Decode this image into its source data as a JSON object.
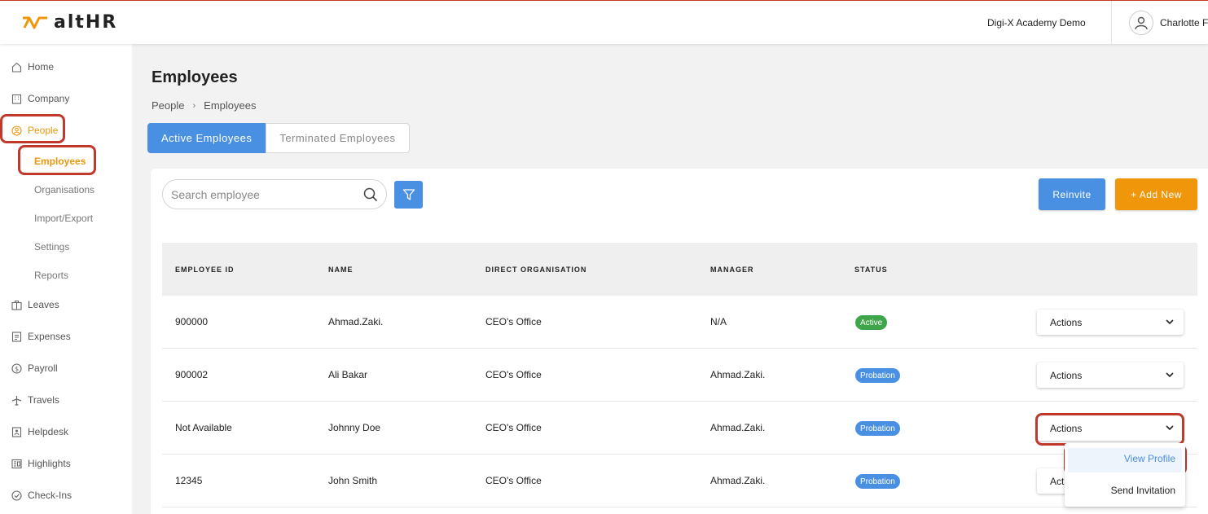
{
  "app": {
    "logo_text": "altHR"
  },
  "header": {
    "org_name": "Digi-X Academy Demo",
    "user_name": "Charlotte Fo"
  },
  "sidebar": {
    "items": [
      {
        "label": "Home",
        "icon": "home-icon"
      },
      {
        "label": "Company",
        "icon": "building-icon"
      },
      {
        "label": "People",
        "icon": "people-icon"
      },
      {
        "label": "Leaves",
        "icon": "briefcase-icon"
      },
      {
        "label": "Expenses",
        "icon": "receipt-icon"
      },
      {
        "label": "Payroll",
        "icon": "dollar-icon"
      },
      {
        "label": "Travels",
        "icon": "plane-icon"
      },
      {
        "label": "Helpdesk",
        "icon": "helpdesk-icon"
      },
      {
        "label": "Highlights",
        "icon": "highlights-icon"
      },
      {
        "label": "Check-Ins",
        "icon": "check-circle-icon"
      }
    ],
    "people_sub": [
      "Employees",
      "Organisations",
      "Import/Export",
      "Settings",
      "Reports"
    ]
  },
  "page": {
    "title": "Employees",
    "breadcrumb": [
      "People",
      "Employees"
    ],
    "tabs": [
      "Active Employees",
      "Terminated Employees"
    ],
    "search_placeholder": "Search employee",
    "reinvite_label": "Reinvite",
    "add_new_label": "+ Add New"
  },
  "table": {
    "columns": [
      "EMPLOYEE ID",
      "NAME",
      "DIRECT ORGANISATION",
      "MANAGER",
      "STATUS"
    ],
    "rows": [
      {
        "id": "900000",
        "name": "Ahmad.Zaki.",
        "org": "CEO's Office",
        "manager": "N/A",
        "status": "Active",
        "actions": "Actions"
      },
      {
        "id": "900002",
        "name": "Ali Bakar",
        "org": "CEO's Office",
        "manager": "Ahmad.Zaki.",
        "status": "Probation",
        "actions": "Actions"
      },
      {
        "id": "Not Available",
        "name": "Johnny Doe",
        "org": "CEO's Office",
        "manager": "Ahmad.Zaki.",
        "status": "Probation",
        "actions": "Actions"
      },
      {
        "id": "12345",
        "name": "John Smith",
        "org": "CEO's Office",
        "manager": "Ahmad.Zaki.",
        "status": "Probation",
        "actions": "Act"
      }
    ]
  },
  "dropdown": {
    "items": [
      "View Profile",
      "Send Invitation"
    ]
  },
  "colors": {
    "primary": "#4a90e2",
    "accent": "#f0960a",
    "active_badge": "#3fa54a",
    "highlight": "#c0392b"
  }
}
